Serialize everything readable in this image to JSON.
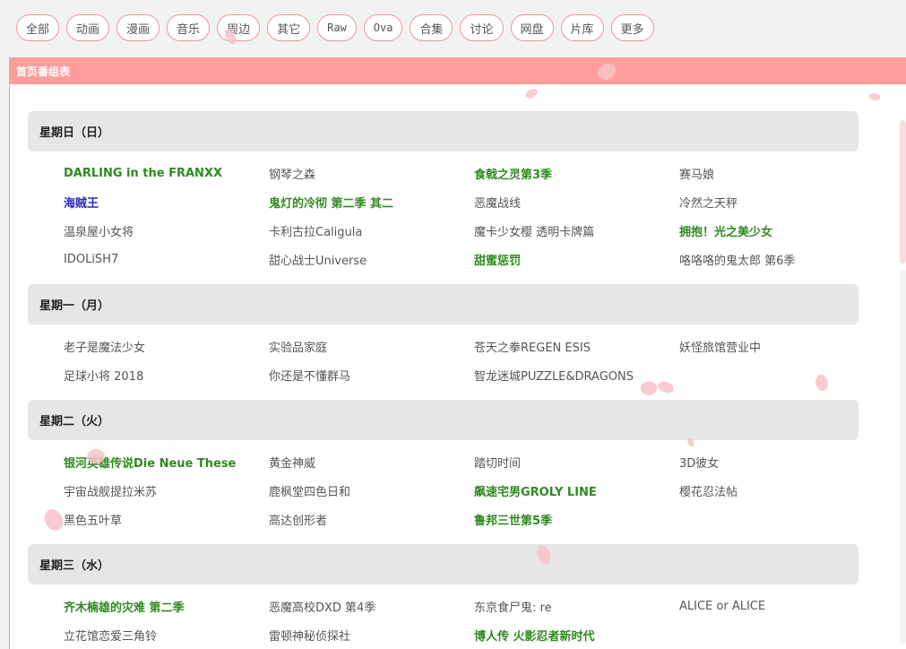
{
  "nav": [
    "全部",
    "动画",
    "漫画",
    "音乐",
    "周边",
    "其它",
    "Raw",
    "Ova",
    "合集",
    "讨论",
    "网盘",
    "片库",
    "更多"
  ],
  "panel_title": "首页番组表",
  "days": [
    {
      "label": "星期日（日）",
      "items": [
        {
          "t": "DARLING in the FRANXX",
          "s": "green"
        },
        {
          "t": "钢琴之森",
          "s": ""
        },
        {
          "t": "食戟之灵第3季",
          "s": "green"
        },
        {
          "t": "赛马娘",
          "s": ""
        },
        {
          "t": "海贼王",
          "s": "blue"
        },
        {
          "t": "鬼灯的冷彻 第二季 其二",
          "s": "green"
        },
        {
          "t": "恶魔战线",
          "s": ""
        },
        {
          "t": "冷然之天秤",
          "s": ""
        },
        {
          "t": "温泉屋小女将",
          "s": ""
        },
        {
          "t": "卡利古拉Caligula",
          "s": ""
        },
        {
          "t": "魔卡少女樱 透明卡牌篇",
          "s": ""
        },
        {
          "t": "拥抱！光之美少女",
          "s": "green"
        },
        {
          "t": "IDOLiSH7",
          "s": ""
        },
        {
          "t": "甜心战士Universe",
          "s": ""
        },
        {
          "t": "甜蜜惩罚",
          "s": "green"
        },
        {
          "t": "咯咯咯的鬼太郎 第6季",
          "s": ""
        }
      ]
    },
    {
      "label": "星期一（月）",
      "items": [
        {
          "t": "老子是魔法少女",
          "s": ""
        },
        {
          "t": "实验品家庭",
          "s": ""
        },
        {
          "t": "苍天之拳REGEN ESIS",
          "s": ""
        },
        {
          "t": "妖怪旅馆营业中",
          "s": ""
        },
        {
          "t": "足球小将 2018",
          "s": ""
        },
        {
          "t": "你还是不懂群马",
          "s": ""
        },
        {
          "t": "智龙迷城PUZZLE&DRAGONS",
          "s": ""
        }
      ]
    },
    {
      "label": "星期二（火）",
      "items": [
        {
          "t": "银河英雄传说Die Neue These",
          "s": "green"
        },
        {
          "t": "黄金神威",
          "s": ""
        },
        {
          "t": "踏切时间",
          "s": ""
        },
        {
          "t": "3D彼女",
          "s": ""
        },
        {
          "t": "宇宙战舰提拉米苏",
          "s": ""
        },
        {
          "t": "鹿枫堂四色日和",
          "s": ""
        },
        {
          "t": "飙速宅男GROLY LINE",
          "s": "green"
        },
        {
          "t": "樱花忍法帖",
          "s": ""
        },
        {
          "t": "黑色五叶草",
          "s": ""
        },
        {
          "t": "高达创形者",
          "s": ""
        },
        {
          "t": "鲁邦三世第5季",
          "s": "green"
        }
      ]
    },
    {
      "label": "星期三（水）",
      "items": [
        {
          "t": "齐木楠雄的灾难 第二季",
          "s": "green"
        },
        {
          "t": "恶魔高校DXD 第4季",
          "s": ""
        },
        {
          "t": "东京食尸鬼: re",
          "s": ""
        },
        {
          "t": "ALICE or ALICE",
          "s": ""
        },
        {
          "t": "立花馆恋爱三角铃",
          "s": ""
        },
        {
          "t": "雷顿神秘侦探社",
          "s": ""
        },
        {
          "t": "博人传 火影忍者新时代",
          "s": "green"
        }
      ]
    }
  ]
}
